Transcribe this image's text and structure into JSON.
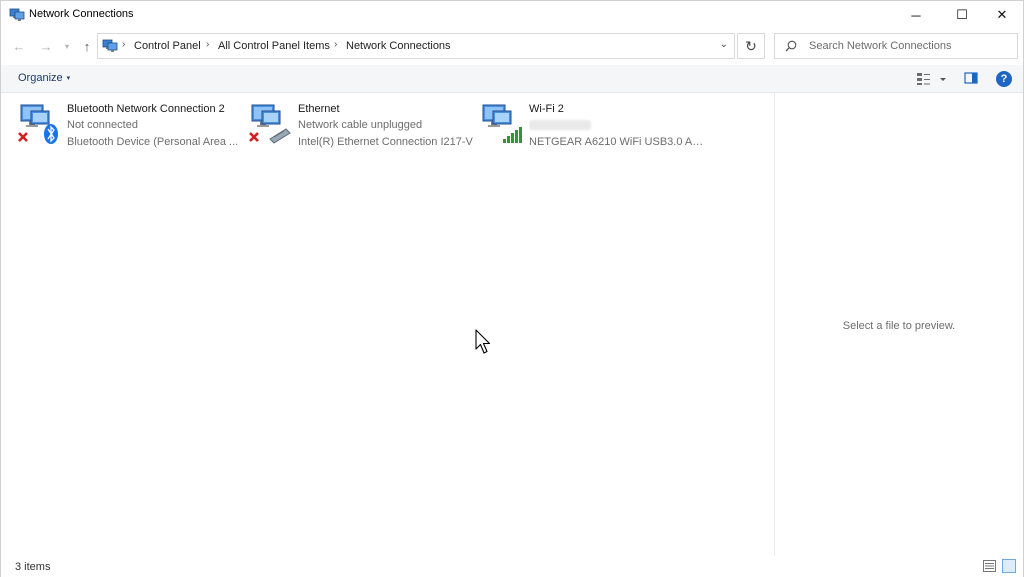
{
  "window": {
    "title": "Network Connections",
    "controls": {
      "minimize": "─",
      "maximize": "☐",
      "close": "✕"
    }
  },
  "nav": {
    "back": "←",
    "forward": "→",
    "recent": "▾",
    "up": "↑",
    "breadcrumbs": [
      "Control Panel",
      "All Control Panel Items",
      "Network Connections"
    ],
    "separator": "›",
    "dropdown": "⌄",
    "refresh": "↻",
    "search_placeholder": "Search Network Connections"
  },
  "toolbar": {
    "organize_label": "Organize",
    "organize_caret": "▾",
    "help_label": "?"
  },
  "items": [
    {
      "name": "Bluetooth Network Connection 2",
      "status": "Not connected",
      "device": "Bluetooth Device (Personal Area ...",
      "icon": "bluetooth-network-icon",
      "state": "disconnected"
    },
    {
      "name": "Ethernet",
      "status": "Network cable unplugged",
      "device": "Intel(R) Ethernet Connection I217-V",
      "icon": "ethernet-network-icon",
      "state": "disconnected"
    },
    {
      "name": "Wi-Fi 2",
      "status": "",
      "device": "NETGEAR A6210 WiFi USB3.0 Ada...",
      "icon": "wifi-network-icon",
      "state": "connected"
    }
  ],
  "preview": {
    "message": "Select a file to preview."
  },
  "statusbar": {
    "count": "3 items"
  },
  "colors": {
    "accent": "#1d66c4",
    "organize_text": "#1e3a6e",
    "secondary_text": "#6d6d6d",
    "disconnect_red": "#d42020",
    "signal_green": "#2e9a2e"
  }
}
